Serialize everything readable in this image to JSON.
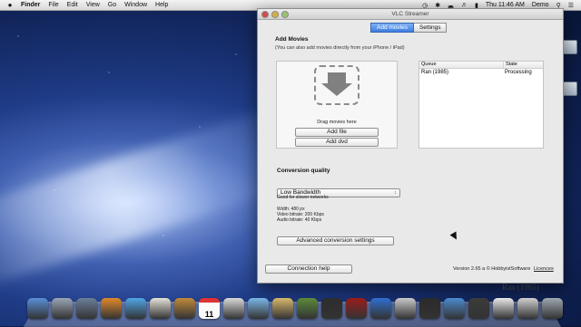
{
  "menubar": {
    "apple": "",
    "items": [
      "Finder",
      "File",
      "Edit",
      "View",
      "Go",
      "Window",
      "Help"
    ],
    "clock": "Thu 11:46 AM",
    "user": "Demo"
  },
  "window": {
    "title": "VLC Streamer",
    "tabs": [
      {
        "label": "Add movies",
        "active": true
      },
      {
        "label": "Settings",
        "active": false
      }
    ],
    "add_movies": {
      "heading": "Add Movies",
      "subtitle": "(You can also add movies directly from your iPhone / iPad)",
      "drop_text": "Drag movies here",
      "add_file": "Add file",
      "add_dvd": "Add dvd"
    },
    "queue": {
      "headers": [
        "Queue",
        "State"
      ],
      "rows": [
        {
          "name": "Ran (1985)",
          "state": "Processing"
        }
      ]
    },
    "conversion": {
      "heading": "Conversion quality",
      "selected": "Low Bandwidth",
      "description": "Good for slower networks",
      "width": "Width: 480 px",
      "video_bitrate": "Video bitrate: 200 Kbps",
      "audio_bitrate": "Audio bitrate: 40 Kbps",
      "advanced_button": "Advanced conversion settings"
    },
    "footer": {
      "connection_help": "Connection help",
      "version": "Version 2.65 a © HobbyistSoftware",
      "licences": "Licences"
    }
  },
  "dock": {
    "ghost_label": "Ran (1985)",
    "calendar_day": "11",
    "colors": [
      "#5a8fd8",
      "#9aa6b6",
      "#6b7f99",
      "#e08a2a",
      "#4fa7e8",
      "#e6e2d8",
      "#c08a3a",
      "#f4f4f4",
      "#d9d9d9",
      "#7ab6e8",
      "#d8b86a",
      "#5c8a3a",
      "#2d2d2d",
      "#9b1c1c",
      "#2f6fd0",
      "#c9c9c9",
      "#2a2a2a",
      "#4b8ad0",
      "#3b3b3b",
      "#e9e9e9",
      "#cfcfcf",
      "#9ea7b0"
    ]
  },
  "colors": {
    "tab_active": "#3d7ee0",
    "window_bg": "#e9e9e9"
  }
}
